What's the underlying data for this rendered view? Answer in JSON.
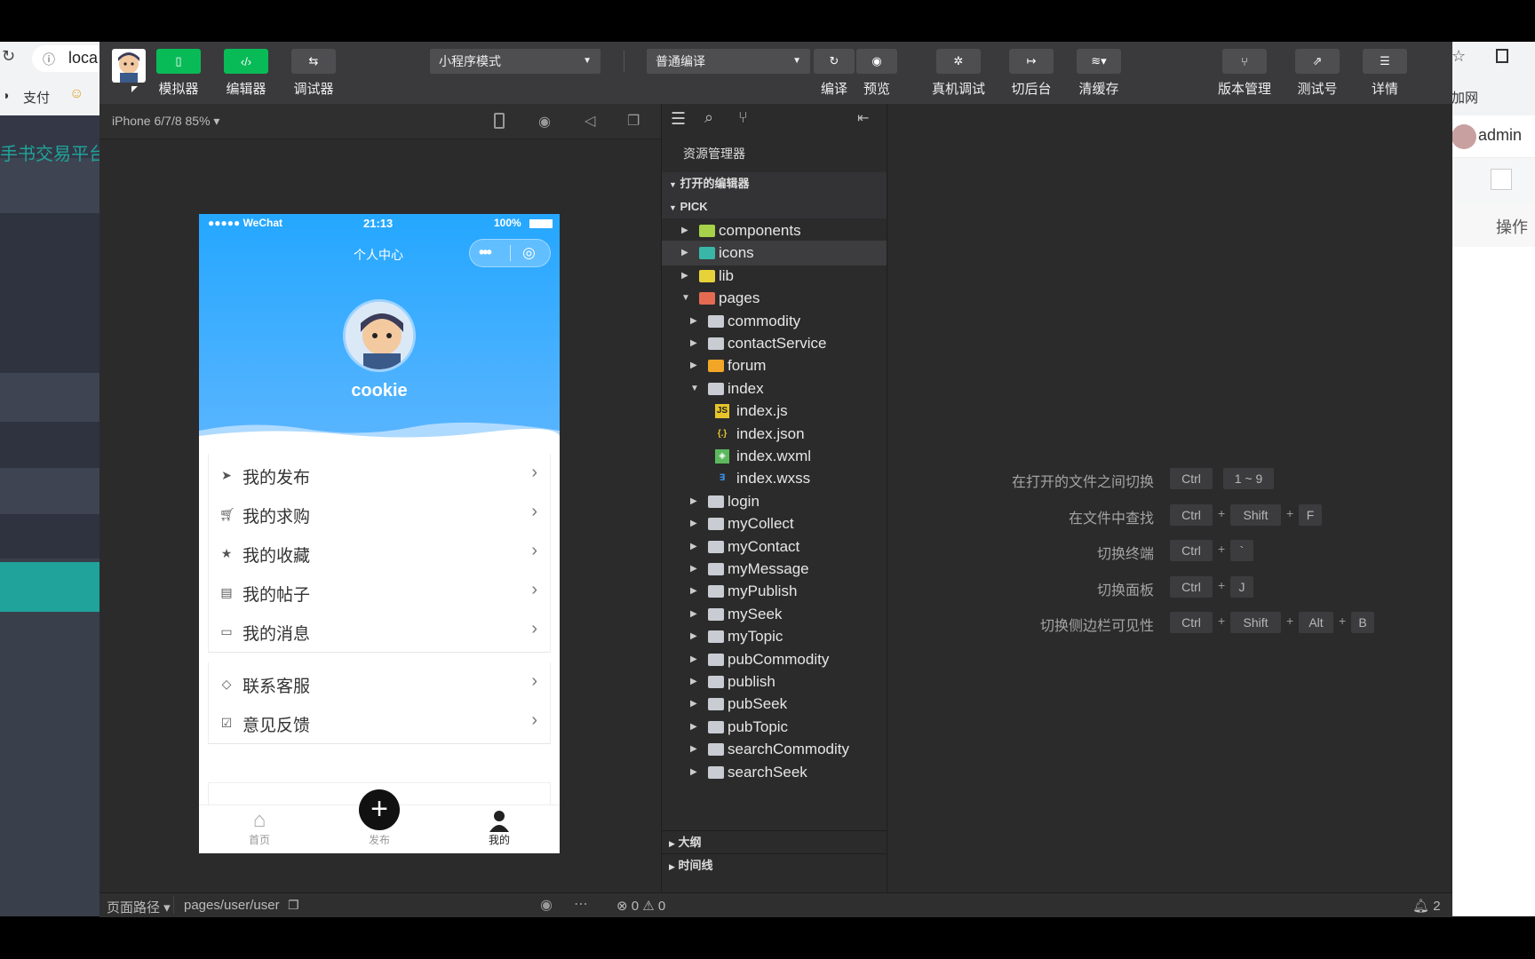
{
  "browser": {
    "address": "loca",
    "bookmark_pay": "支付",
    "bg_site_title": "手书交易平台",
    "bg_right_text_1": "加网",
    "bg_admin": "admin",
    "bg_operation": "操作"
  },
  "toolbar": {
    "simulator": "模拟器",
    "editor": "编辑器",
    "debugger": "调试器",
    "mode_select": "小程序模式",
    "compile_select": "普通编译",
    "compile": "编译",
    "preview": "预览",
    "real_debug": "真机调试",
    "background": "切后台",
    "clear_cache": "清缓存",
    "version": "版本管理",
    "test_account": "测试号",
    "details": "详情"
  },
  "simulator": {
    "device": "iPhone 6/7/8 85%",
    "status_carrier": "●●●●● WeChat",
    "status_time": "21:13",
    "status_battery": "100%",
    "nav_title": "个人中心",
    "username": "cookie",
    "menu": [
      {
        "icon": "send-icon",
        "label": "我的发布"
      },
      {
        "icon": "cart-icon",
        "label": "我的求购"
      },
      {
        "icon": "star-icon",
        "label": "我的收藏"
      },
      {
        "icon": "post-icon",
        "label": "我的帖子"
      },
      {
        "icon": "message-icon",
        "label": "我的消息"
      },
      {
        "icon": "service-icon",
        "label": "联系客服"
      },
      {
        "icon": "feedback-icon",
        "label": "意见反馈"
      }
    ],
    "tabbar": {
      "home": "首页",
      "publish": "发布",
      "mine": "我的"
    },
    "tabbar_colors": {
      "active": "#222222",
      "inactive": "#999999"
    }
  },
  "explorer": {
    "title": "资源管理器",
    "open_editors": "打开的编辑器",
    "project": "PICK",
    "tree": [
      {
        "name": "components",
        "level": 1,
        "expanded": false,
        "kind": "folder-green"
      },
      {
        "name": "icons",
        "level": 1,
        "expanded": false,
        "kind": "folder-teal",
        "highlight": true
      },
      {
        "name": "lib",
        "level": 1,
        "expanded": false,
        "kind": "folder-yellow"
      },
      {
        "name": "pages",
        "level": 1,
        "expanded": true,
        "kind": "folder-red"
      },
      {
        "name": "commodity",
        "level": 2,
        "expanded": false,
        "kind": "folder"
      },
      {
        "name": "contactService",
        "level": 2,
        "expanded": false,
        "kind": "folder"
      },
      {
        "name": "forum",
        "level": 2,
        "expanded": false,
        "kind": "folder-orange"
      },
      {
        "name": "index",
        "level": 2,
        "expanded": true,
        "kind": "folder-open"
      },
      {
        "name": "index.js",
        "level": 3,
        "kind": "file-js"
      },
      {
        "name": "index.json",
        "level": 3,
        "kind": "file-json"
      },
      {
        "name": "index.wxml",
        "level": 3,
        "kind": "file-wxml"
      },
      {
        "name": "index.wxss",
        "level": 3,
        "kind": "file-wxss"
      },
      {
        "name": "login",
        "level": 2,
        "expanded": false,
        "kind": "folder"
      },
      {
        "name": "myCollect",
        "level": 2,
        "expanded": false,
        "kind": "folder"
      },
      {
        "name": "myContact",
        "level": 2,
        "expanded": false,
        "kind": "folder"
      },
      {
        "name": "myMessage",
        "level": 2,
        "expanded": false,
        "kind": "folder"
      },
      {
        "name": "myPublish",
        "level": 2,
        "expanded": false,
        "kind": "folder"
      },
      {
        "name": "mySeek",
        "level": 2,
        "expanded": false,
        "kind": "folder"
      },
      {
        "name": "myTopic",
        "level": 2,
        "expanded": false,
        "kind": "folder"
      },
      {
        "name": "pubCommodity",
        "level": 2,
        "expanded": false,
        "kind": "folder"
      },
      {
        "name": "publish",
        "level": 2,
        "expanded": false,
        "kind": "folder"
      },
      {
        "name": "pubSeek",
        "level": 2,
        "expanded": false,
        "kind": "folder"
      },
      {
        "name": "pubTopic",
        "level": 2,
        "expanded": false,
        "kind": "folder"
      },
      {
        "name": "searchCommodity",
        "level": 2,
        "expanded": false,
        "kind": "folder"
      },
      {
        "name": "searchSeek",
        "level": 2,
        "expanded": false,
        "kind": "folder"
      }
    ],
    "outline": "大纲",
    "timeline": "时间线"
  },
  "shortcuts": [
    {
      "label": "在打开的文件之间切换",
      "keys": [
        "Ctrl",
        "1 ~ 9"
      ],
      "sep": ""
    },
    {
      "label": "在文件中查找",
      "keys": [
        "Ctrl",
        "Shift",
        "F"
      ],
      "sep": "+"
    },
    {
      "label": "切换终端",
      "keys": [
        "Ctrl",
        "`"
      ],
      "sep": "+"
    },
    {
      "label": "切换面板",
      "keys": [
        "Ctrl",
        "J"
      ],
      "sep": "+"
    },
    {
      "label": "切换侧边栏可见性",
      "keys": [
        "Ctrl",
        "Shift",
        "Alt",
        "B"
      ],
      "sep": "+"
    }
  ],
  "statusbar": {
    "page_path_label": "页面路径",
    "page_path": "pages/user/user",
    "errors": "0",
    "warnings": "0",
    "notifications": "2"
  },
  "colors": {
    "accent_green": "#09bb57",
    "phone_blue": "#2aa9ff",
    "site_teal": "#1fa39a"
  }
}
